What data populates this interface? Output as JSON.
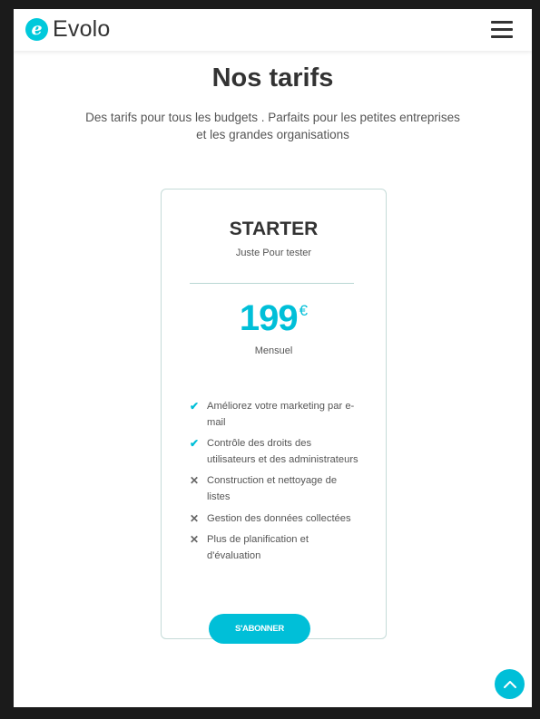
{
  "navbar": {
    "logo_letter": "e",
    "logo_text": "Evolo",
    "menu_icon": "hamburger-icon"
  },
  "section": {
    "title": "Nos tarifs",
    "subtitle_line1": "Des tarifs pour tous les budgets . Parfaits pour les petites entreprises",
    "subtitle_line2": "et les grandes organisations"
  },
  "plan": {
    "name": "STARTER",
    "tagline": "Juste Pour tester",
    "price": "199",
    "currency": "€",
    "period": "Mensuel",
    "features": [
      {
        "icon": "check-icon",
        "text": "Améliorez votre marketing par e-mail",
        "included": true
      },
      {
        "icon": "check-icon",
        "text": "Contrôle des droits des utilisateurs et des administrateurs",
        "included": true
      },
      {
        "icon": "cross-icon",
        "text": "Construction et nettoyage de listes",
        "included": false
      },
      {
        "icon": "cross-icon",
        "text": "Gestion des données collectées",
        "included": false
      },
      {
        "icon": "cross-icon",
        "text": "Plus de planification et d'évaluation",
        "included": false
      }
    ],
    "cta_label": "S'ABONNER"
  },
  "scroll_top": {
    "icon": "chevron-up-icon"
  },
  "colors": {
    "accent": "#00bfd8",
    "text_dark": "#333333",
    "text_body": "#555555",
    "background": "#ffffff"
  }
}
